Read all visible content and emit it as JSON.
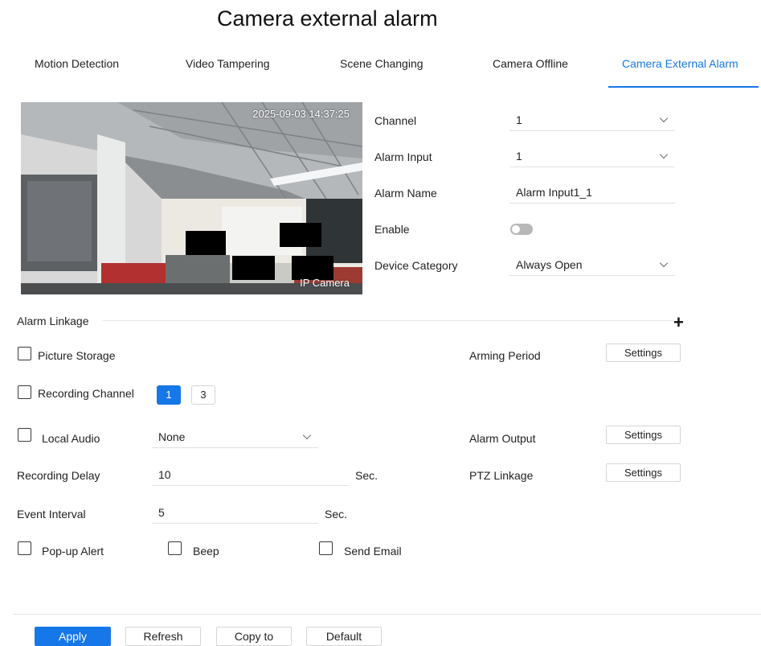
{
  "page": {
    "title": "Camera external alarm"
  },
  "tabs": [
    {
      "label": "Motion Detection",
      "active": false
    },
    {
      "label": "Video Tampering",
      "active": false
    },
    {
      "label": "Scene Changing",
      "active": false
    },
    {
      "label": "Camera Offline",
      "active": false
    },
    {
      "label": "Camera External Alarm",
      "active": true
    }
  ],
  "preview": {
    "timestamp": "2025-09-03 14:37:25",
    "camera_label": "IP Camera"
  },
  "form": {
    "channel": {
      "label": "Channel",
      "value": "1"
    },
    "alarm_input": {
      "label": "Alarm Input",
      "value": "1"
    },
    "alarm_name": {
      "label": "Alarm Name",
      "value": "Alarm Input1_1"
    },
    "enable": {
      "label": "Enable",
      "state": "off"
    },
    "device_category": {
      "label": "Device Category",
      "value": "Always Open"
    }
  },
  "linkage": {
    "title": "Alarm Linkage",
    "picture_storage": {
      "label": "Picture Storage",
      "checked": false
    },
    "recording_channel": {
      "label": "Recording Channel",
      "checked": false,
      "channels": [
        "1",
        "3"
      ],
      "selected": "1"
    },
    "local_audio": {
      "label": "Local Audio",
      "checked": false,
      "value": "None"
    },
    "recording_delay": {
      "label": "Recording Delay",
      "value": "10",
      "unit": "Sec."
    },
    "event_interval": {
      "label": "Event Interval",
      "value": "5",
      "unit": "Sec."
    },
    "popup_alert": {
      "label": "Pop-up Alert",
      "checked": false
    },
    "beep": {
      "label": "Beep",
      "checked": false
    },
    "send_email": {
      "label": "Send Email",
      "checked": false
    },
    "arming_period": {
      "label": "Arming Period",
      "button": "Settings"
    },
    "alarm_output": {
      "label": "Alarm Output",
      "button": "Settings"
    },
    "ptz_linkage": {
      "label": "PTZ Linkage",
      "button": "Settings"
    }
  },
  "footer": {
    "apply": "Apply",
    "refresh": "Refresh",
    "copy_to": "Copy to",
    "default": "Default"
  },
  "colors": {
    "accent": "#1677e8",
    "toggle_off": "#b8b8b8"
  },
  "icons": [
    "chevron-down-icon",
    "plus-icon",
    "checkbox-icon",
    "toggle-icon"
  ]
}
